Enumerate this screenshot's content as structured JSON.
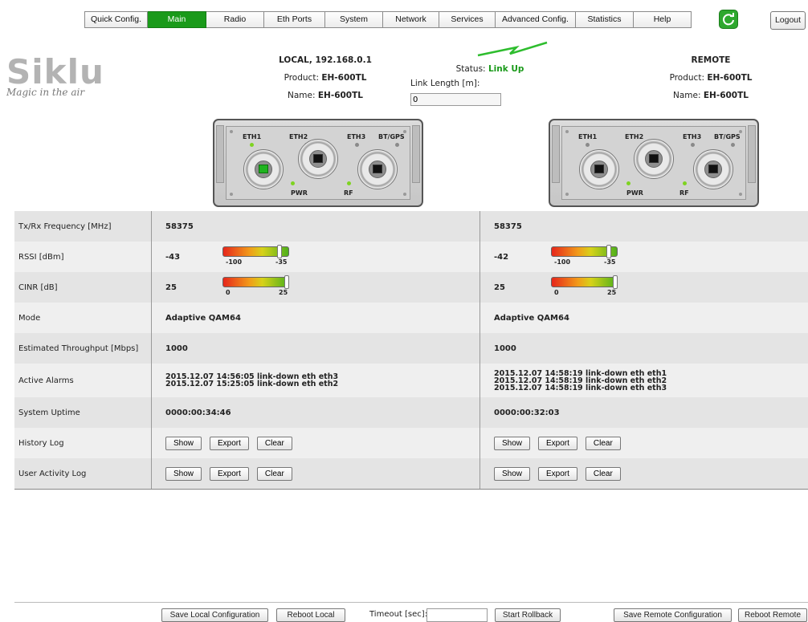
{
  "nav": {
    "items": [
      {
        "label": "Quick Config.",
        "active": false
      },
      {
        "label": "Main",
        "active": true
      },
      {
        "label": "Radio",
        "active": false
      },
      {
        "label": "Eth Ports",
        "active": false
      },
      {
        "label": "System",
        "active": false
      },
      {
        "label": "Network",
        "active": false
      },
      {
        "label": "Services",
        "active": false
      },
      {
        "label": "Advanced Config.",
        "active": false
      },
      {
        "label": "Statistics",
        "active": false
      },
      {
        "label": "Help",
        "active": false
      }
    ],
    "refresh_icon": "refresh-icon",
    "logout": "Logout"
  },
  "logo": {
    "word": "Siklu",
    "tagline": "Magic in the air"
  },
  "local": {
    "title": "LOCAL, 192.168.0.1",
    "product_label": "Product: ",
    "product": "EH-600TL",
    "name_label": "Name: ",
    "name": "EH-600TL"
  },
  "remote": {
    "title": "REMOTE",
    "product_label": "Product: ",
    "product": "EH-600TL",
    "name_label": "Name: ",
    "name": "EH-600TL"
  },
  "link": {
    "status_label": "Status: ",
    "status": "Link Up",
    "length_label": "Link Length [m]:",
    "length_value": "0",
    "bolt_color": "#2ebd2e"
  },
  "device": {
    "eth1": "ETH1",
    "eth2": "ETH2",
    "eth3": "ETH3",
    "btgps": "BT/GPS",
    "pwr": "PWR",
    "rf": "RF"
  },
  "table": {
    "freq": {
      "label": "Tx/Rx Frequency [MHz]",
      "local": "58375",
      "remote": "58375"
    },
    "rssi": {
      "label": "RSSI [dBm]",
      "local": "-43",
      "remote": "-42",
      "min": "-100",
      "max": "-35",
      "local_level": 0.88,
      "remote_level": 0.89
    },
    "cinr": {
      "label": "CINR [dB]",
      "local": "25",
      "remote": "25",
      "min": "0",
      "max": "25",
      "local_level": 1.0,
      "remote_level": 1.0
    },
    "mode": {
      "label": "Mode",
      "local": "Adaptive QAM64",
      "remote": "Adaptive QAM64"
    },
    "throughput": {
      "label": "Estimated Throughput [Mbps]",
      "local": "1000",
      "remote": "1000"
    },
    "alarms": {
      "label": "Active Alarms",
      "local": [
        "2015.12.07 14:56:05 link-down eth eth3",
        "2015.12.07 15:25:05 link-down eth eth2"
      ],
      "remote": [
        "2015.12.07 14:58:19 link-down eth eth1",
        "2015.12.07 14:58:19 link-down eth eth2",
        "2015.12.07 14:58:19 link-down eth eth3"
      ]
    },
    "uptime": {
      "label": "System Uptime",
      "local": "0000:00:34:46",
      "remote": "0000:00:32:03"
    },
    "history": {
      "label": "History Log"
    },
    "activity": {
      "label": "User Activity Log"
    },
    "buttons": {
      "show": "Show",
      "export": "Export",
      "clear": "Clear"
    }
  },
  "footer": {
    "save_local": "Save Local Configuration",
    "reboot_local": "Reboot Local",
    "timeout_label": "Timeout [sec]:",
    "timeout_value": "",
    "start_rollback": "Start Rollback",
    "save_remote": "Save Remote Configuration",
    "reboot_remote": "Reboot Remote"
  }
}
